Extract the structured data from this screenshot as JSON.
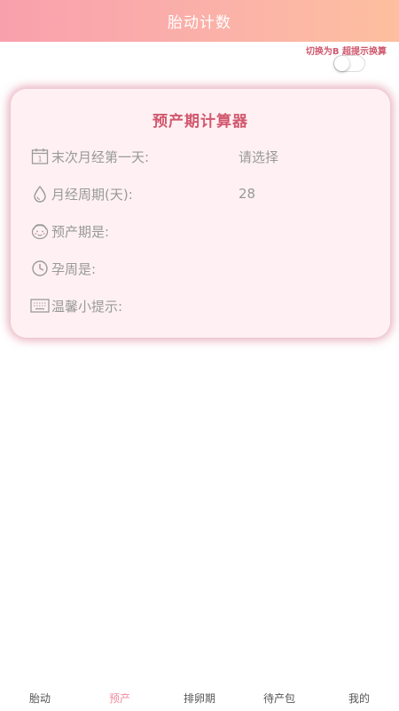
{
  "header": {
    "title": "胎动计数"
  },
  "toggle": {
    "label": "切换为B 超提示换算",
    "state": false
  },
  "card": {
    "title": "预产期计算器",
    "rows": [
      {
        "icon": "calendar-icon",
        "label": "末次月经第一天:",
        "value": "请选择"
      },
      {
        "icon": "drop-icon",
        "label": "月经周期(天):",
        "value": "28"
      },
      {
        "icon": "baby-face-icon",
        "label": "预产期是:",
        "value": ""
      },
      {
        "icon": "clock-icon",
        "label": "孕周是:",
        "value": ""
      },
      {
        "icon": "keyboard-icon",
        "label": "温馨小提示:",
        "value": ""
      }
    ]
  },
  "tabbar": {
    "tabs": [
      "胎动",
      "预产",
      "排卵期",
      "待产包",
      "我的"
    ],
    "active": "预产"
  },
  "colors": {
    "accent": "#f08ea0",
    "title": "#d2586e",
    "text": "#999999"
  }
}
